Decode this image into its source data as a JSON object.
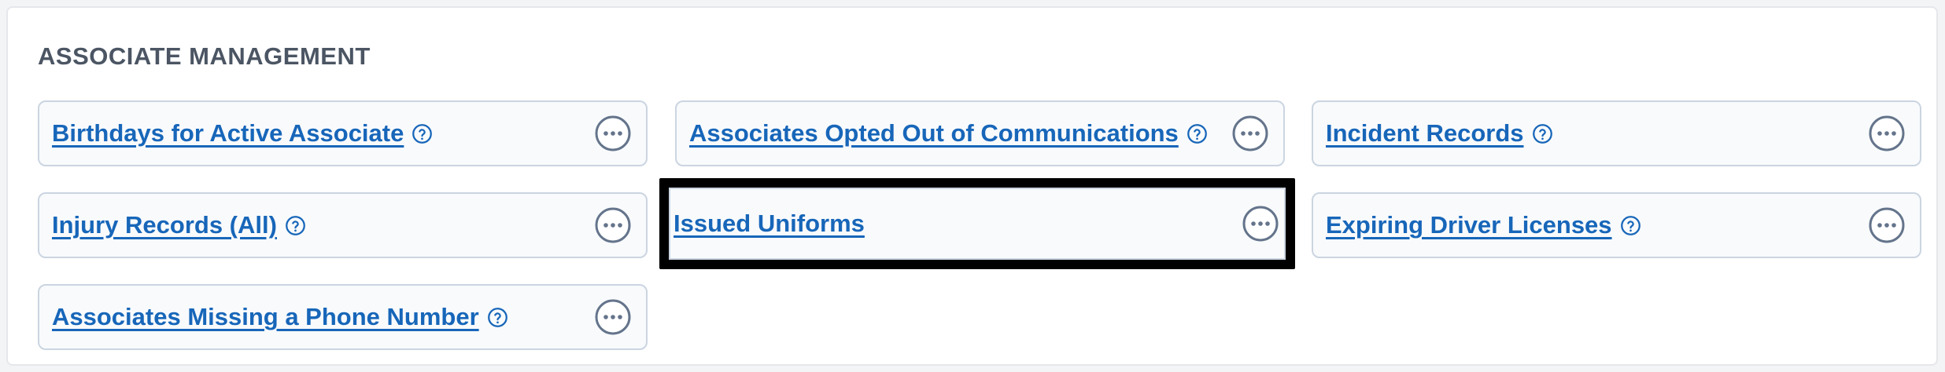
{
  "section": {
    "title": "ASSOCIATE MANAGEMENT"
  },
  "reports": [
    {
      "label": "Birthdays for Active Associate",
      "has_help": true,
      "icon": "help-circle-icon"
    },
    {
      "label": "Associates Opted Out of Communications",
      "has_help": true,
      "icon": "help-circle-icon"
    },
    {
      "label": "Incident Records",
      "has_help": true,
      "icon": "help-circle-icon"
    },
    {
      "label": "Injury Records (All)",
      "has_help": true,
      "icon": "help-circle-icon"
    },
    {
      "label": "Issued Uniforms",
      "has_help": false,
      "selected": true
    },
    {
      "label": "Expiring Driver Licenses",
      "has_help": true,
      "icon": "help-circle-icon"
    },
    {
      "label": "Associates Missing a Phone Number",
      "has_help": true,
      "icon": "help-circle-icon"
    }
  ],
  "more_icon": "more-horizontal-icon",
  "colors": {
    "link": "#1766b9",
    "title": "#4b5563",
    "card_border": "#cbd5e1",
    "icon": "#64748b",
    "selection": "#000000"
  }
}
